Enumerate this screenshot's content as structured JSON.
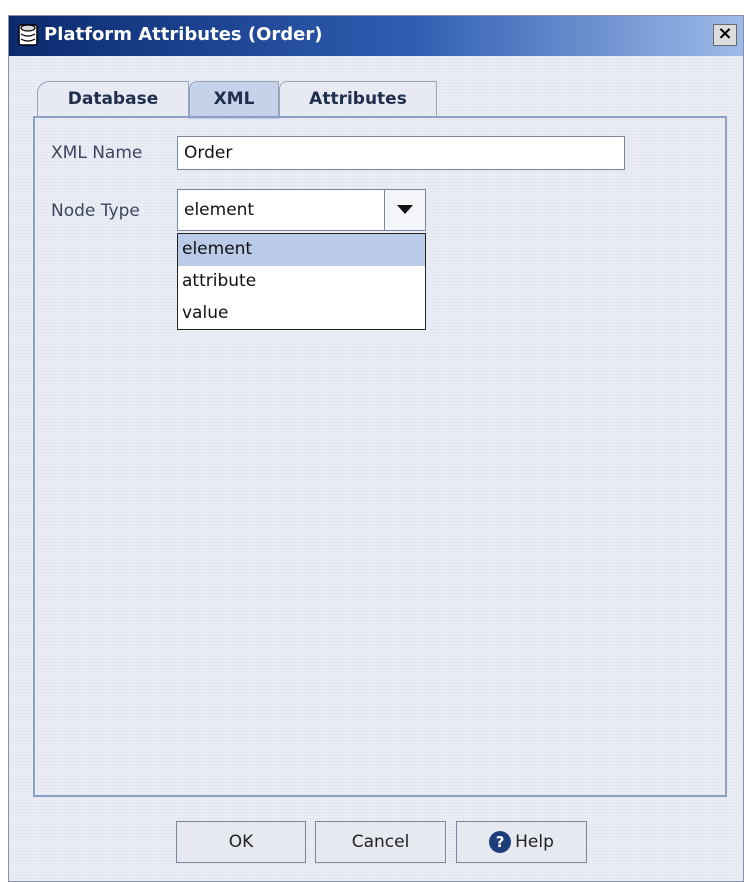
{
  "window": {
    "title": "Platform Attributes (Order)",
    "close_glyph": "×",
    "icon": "database-icon"
  },
  "tabs": [
    {
      "label": "Database",
      "active": false
    },
    {
      "label": "XML",
      "active": true
    },
    {
      "label": "Attributes",
      "active": false
    }
  ],
  "form": {
    "xml_name_label": "XML Name",
    "xml_name_value": "Order",
    "node_type_label": "Node Type",
    "node_type_value": "element",
    "node_type_options": [
      "element",
      "attribute",
      "value"
    ],
    "node_type_highlighted": "element"
  },
  "buttons": {
    "ok": "OK",
    "cancel": "Cancel",
    "help": "Help",
    "help_icon": "?"
  },
  "colors": {
    "titlebar_start": "#0b2a6e",
    "titlebar_end": "#9ebbe8",
    "highlight": "#b9cbe9"
  }
}
